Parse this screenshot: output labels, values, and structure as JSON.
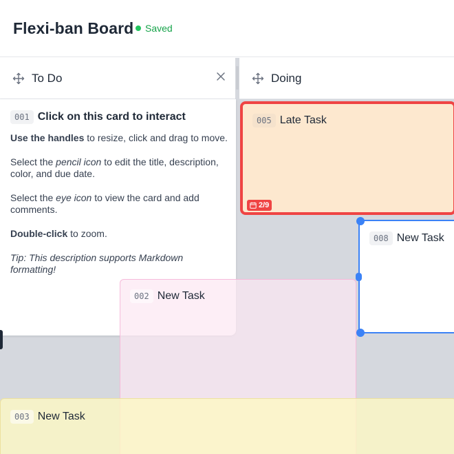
{
  "app": {
    "title": "Flexi-ban Board",
    "status": "Saved",
    "colors": {
      "saved": "#16a34a",
      "selected": "#3b82f6",
      "overdue": "#ef4444"
    }
  },
  "columns": [
    {
      "title": "To Do",
      "icon": "move-icon",
      "close_icon": "close-icon"
    },
    {
      "title": "Doing",
      "icon": "move-icon"
    }
  ],
  "cards": {
    "card1": {
      "id": "001",
      "title": "Click on this card to interact",
      "desc": {
        "p1_bold": "Use the handles",
        "p1_rest": " to resize, click and drag to move.",
        "p2_a": "Select the ",
        "p2_em": "pencil icon",
        "p2_b": " to edit the title, description, color, and due date.",
        "p3_a": "Select the ",
        "p3_em": "eye icon",
        "p3_b": " to view the card and add comments.",
        "p4_bold": "Double-click",
        "p4_rest": " to zoom.",
        "tip": "Tip: This description supports Markdown formatting!"
      }
    },
    "card5": {
      "id": "005",
      "title": "Late Task",
      "due": "2/9",
      "due_icon": "calendar-icon",
      "color": "#fde8cf"
    },
    "card8": {
      "id": "008",
      "title": "New Task"
    },
    "card2": {
      "id": "002",
      "title": "New Task",
      "color": "#fce7f3"
    },
    "card3": {
      "id": "003",
      "title": "New Task",
      "color": "#fef9c3"
    }
  }
}
